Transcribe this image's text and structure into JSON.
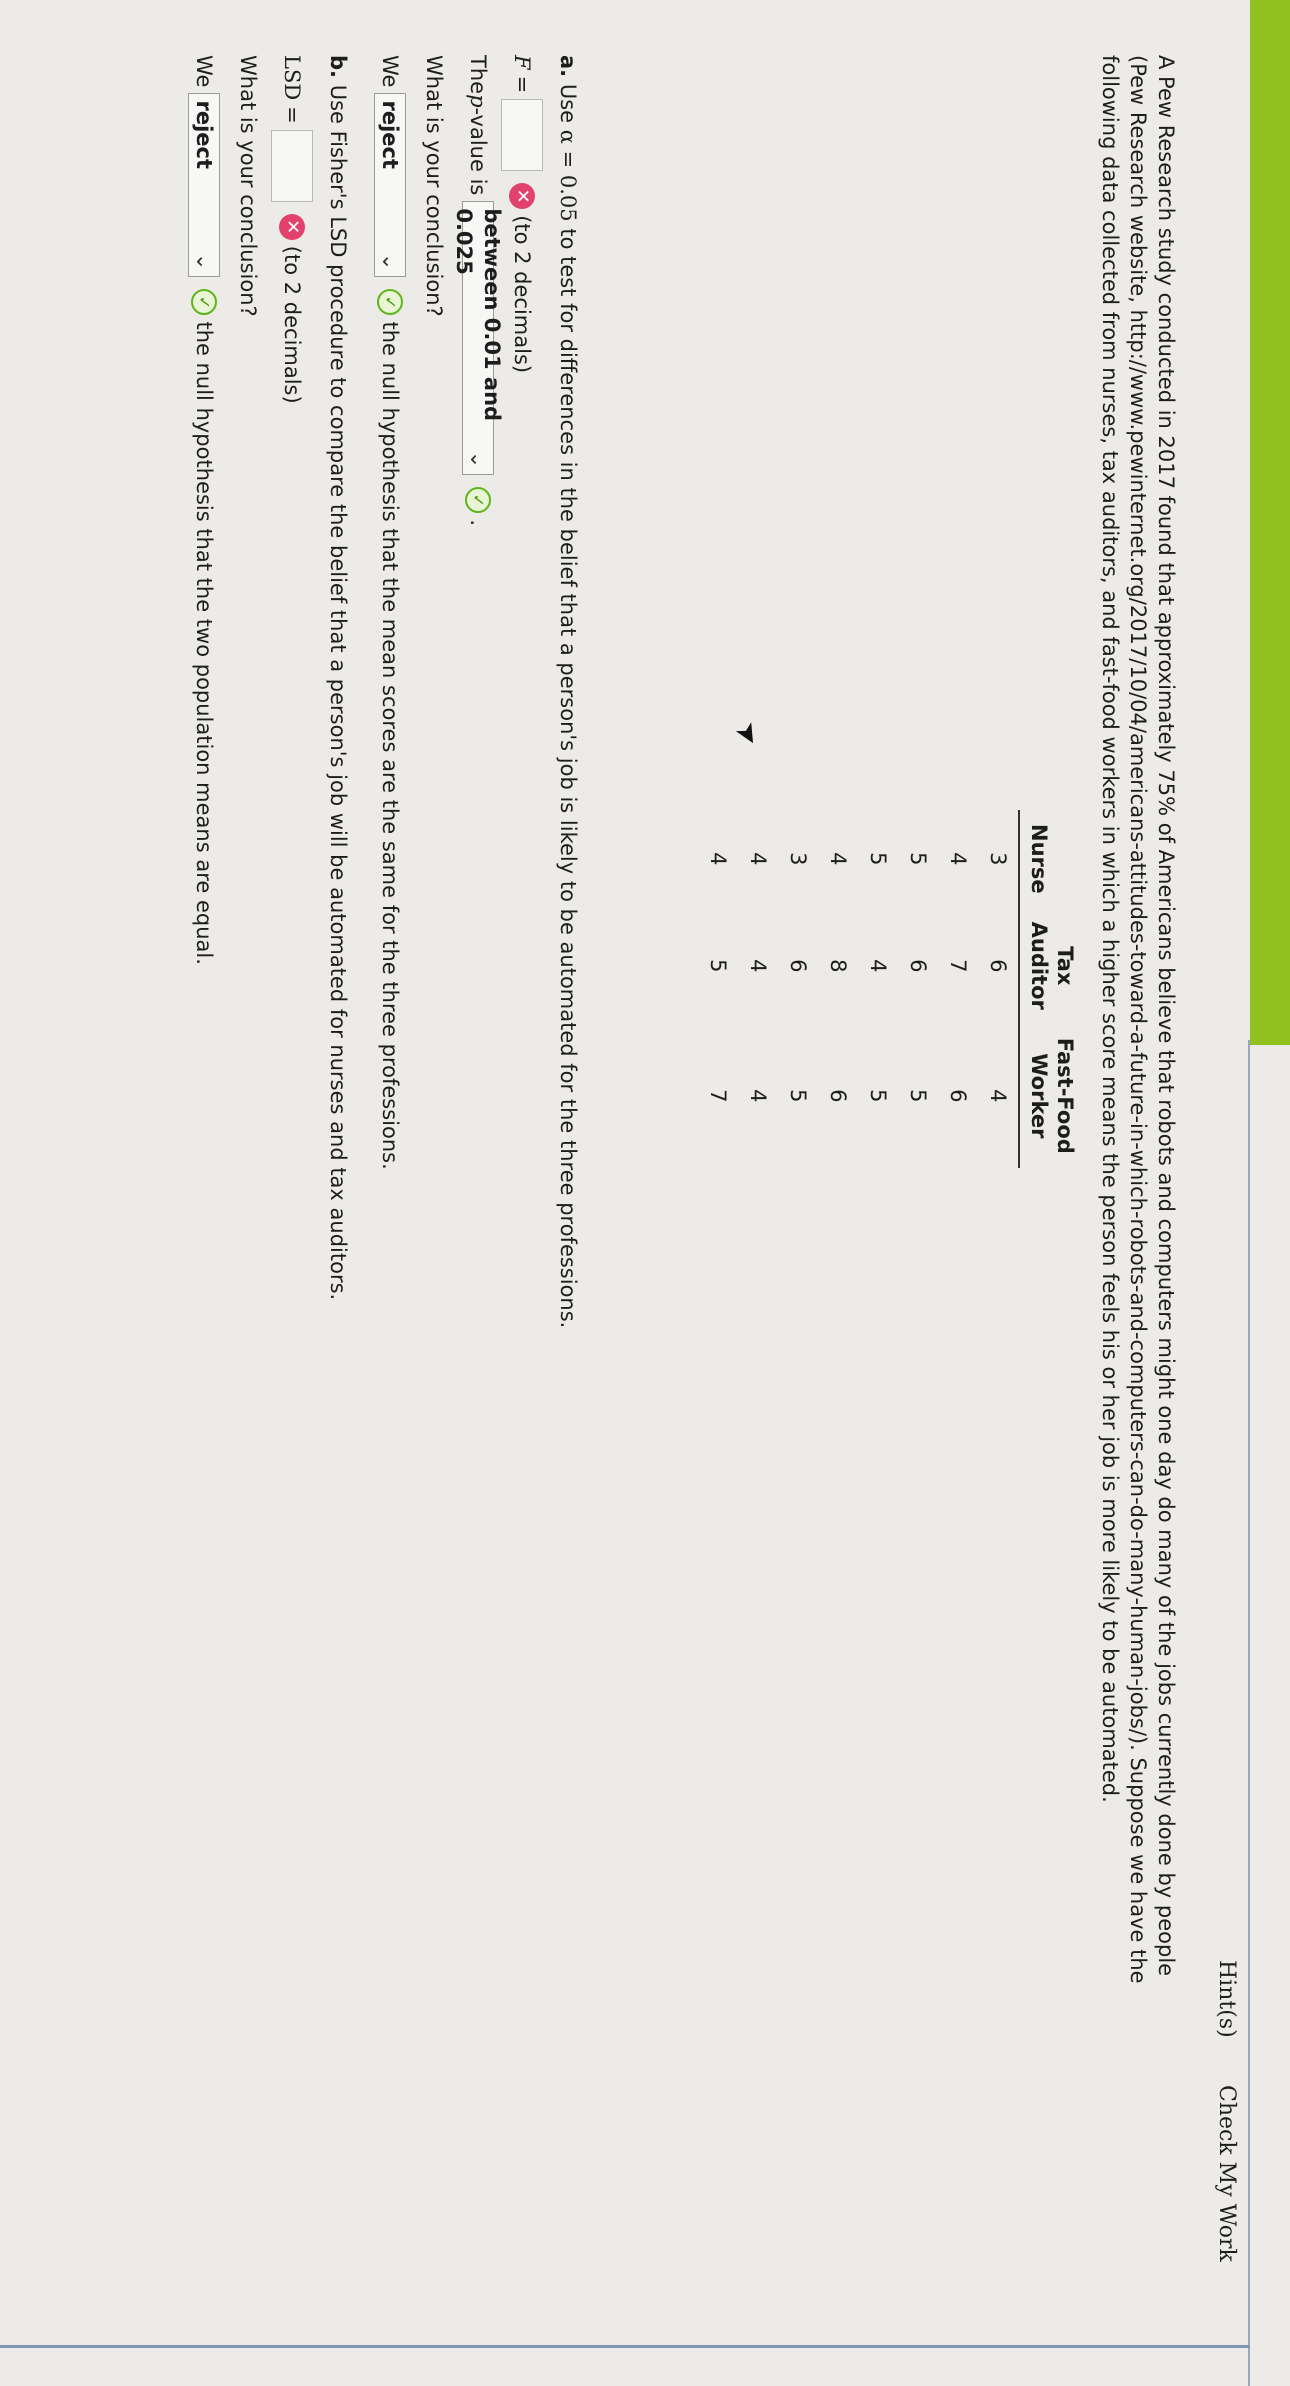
{
  "header": {
    "hint_label": "Hint(s)",
    "check_label": "Check My Work"
  },
  "intro": "A Pew Research study conducted in 2017 found that approximately 75% of Americans believe that robots and computers might one day do many of the jobs currently done by people (Pew Research website, http://www.pewinternet.org/2017/10/04/americans-attitudes-toward-a-future-in-which-robots-and-computers-can-do-many-human-jobs/). Suppose we have the following data collected from nurses, tax auditors, and fast-food workers in which a higher score means the person feels his or her job is more likely to be automated.",
  "table": {
    "headers": [
      {
        "line1": "",
        "line2": "Nurse"
      },
      {
        "line1": "Tax",
        "line2": "Auditor"
      },
      {
        "line1": "Fast-Food",
        "line2": "Worker"
      }
    ],
    "rows": [
      [
        "3",
        "6",
        "4"
      ],
      [
        "4",
        "7",
        "6"
      ],
      [
        "5",
        "6",
        "5"
      ],
      [
        "5",
        "4",
        "5"
      ],
      [
        "4",
        "8",
        "6"
      ],
      [
        "3",
        "6",
        "5"
      ],
      [
        "4",
        "4",
        "4"
      ],
      [
        "4",
        "5",
        "7"
      ]
    ]
  },
  "part_a": {
    "label": "a.",
    "prompt_pre": "Use ",
    "alpha": "α = 0.05",
    "prompt_post": " to test for differences in the belief that a person's job is likely to be automated for the three professions.",
    "f_label": "F",
    "equals": "=",
    "f_note": "(to 2 decimals)",
    "p_pre": "The ",
    "p_sym": "p",
    "p_post": "-value is",
    "p_selected": "between 0.01 and 0.025",
    "p_end": ".",
    "conclusion_q": "What is your conclusion?",
    "we": "We",
    "decision_selected": "reject",
    "conclusion_text": "the null hypothesis that the mean scores are the same for the three professions."
  },
  "part_b": {
    "label": "b.",
    "prompt": "Use Fisher's LSD procedure to compare the belief that a person's job will be automated for nurses and tax auditors.",
    "lsd_label": "LSD",
    "equals": "=",
    "lsd_note": "(to 2 decimals)",
    "conclusion_q": "What is your conclusion?",
    "we": "We",
    "decision_selected": "reject",
    "conclusion_text": "the null hypothesis that the two population means are equal."
  },
  "icons": {
    "wrong": "x-mark",
    "right": "check-mark",
    "dropdown": "chevron-down"
  },
  "colors": {
    "accent_green": "#8fc21f",
    "wrong_red": "#e2416d",
    "correct_green": "#5fb51c"
  }
}
